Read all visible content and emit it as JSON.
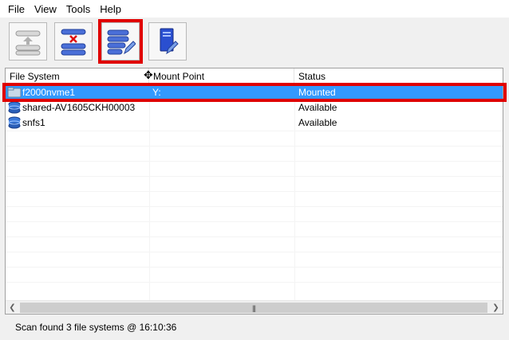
{
  "menu": {
    "items": [
      {
        "label": "File"
      },
      {
        "label": "View"
      },
      {
        "label": "Tools"
      },
      {
        "label": "Help"
      }
    ]
  },
  "toolbar": {
    "buttons": [
      {
        "name": "scan-button",
        "icon": "upload-list-icon"
      },
      {
        "name": "unmount-button",
        "icon": "remove-list-icon"
      },
      {
        "name": "edit-mount-button",
        "icon": "list-edit-icon",
        "highlighted": true
      },
      {
        "name": "server-edit-button",
        "icon": "server-edit-icon"
      }
    ]
  },
  "table": {
    "columns": [
      {
        "label": "File System"
      },
      {
        "label": "Mount Point"
      },
      {
        "label": "Status"
      }
    ],
    "rows": [
      {
        "filesystem": "f2000nvme1",
        "mount": "Y:",
        "status": "Mounted",
        "selected": true
      },
      {
        "filesystem": "shared-AV1605CKH00003",
        "mount": "",
        "status": "Available",
        "selected": false
      },
      {
        "filesystem": "snfs1",
        "mount": "",
        "status": "Available",
        "selected": false
      }
    ]
  },
  "status": {
    "text": "Scan found 3 file systems @ 16:10:36"
  },
  "colors": {
    "selection": "#3399ff",
    "highlight": "#e00000"
  }
}
